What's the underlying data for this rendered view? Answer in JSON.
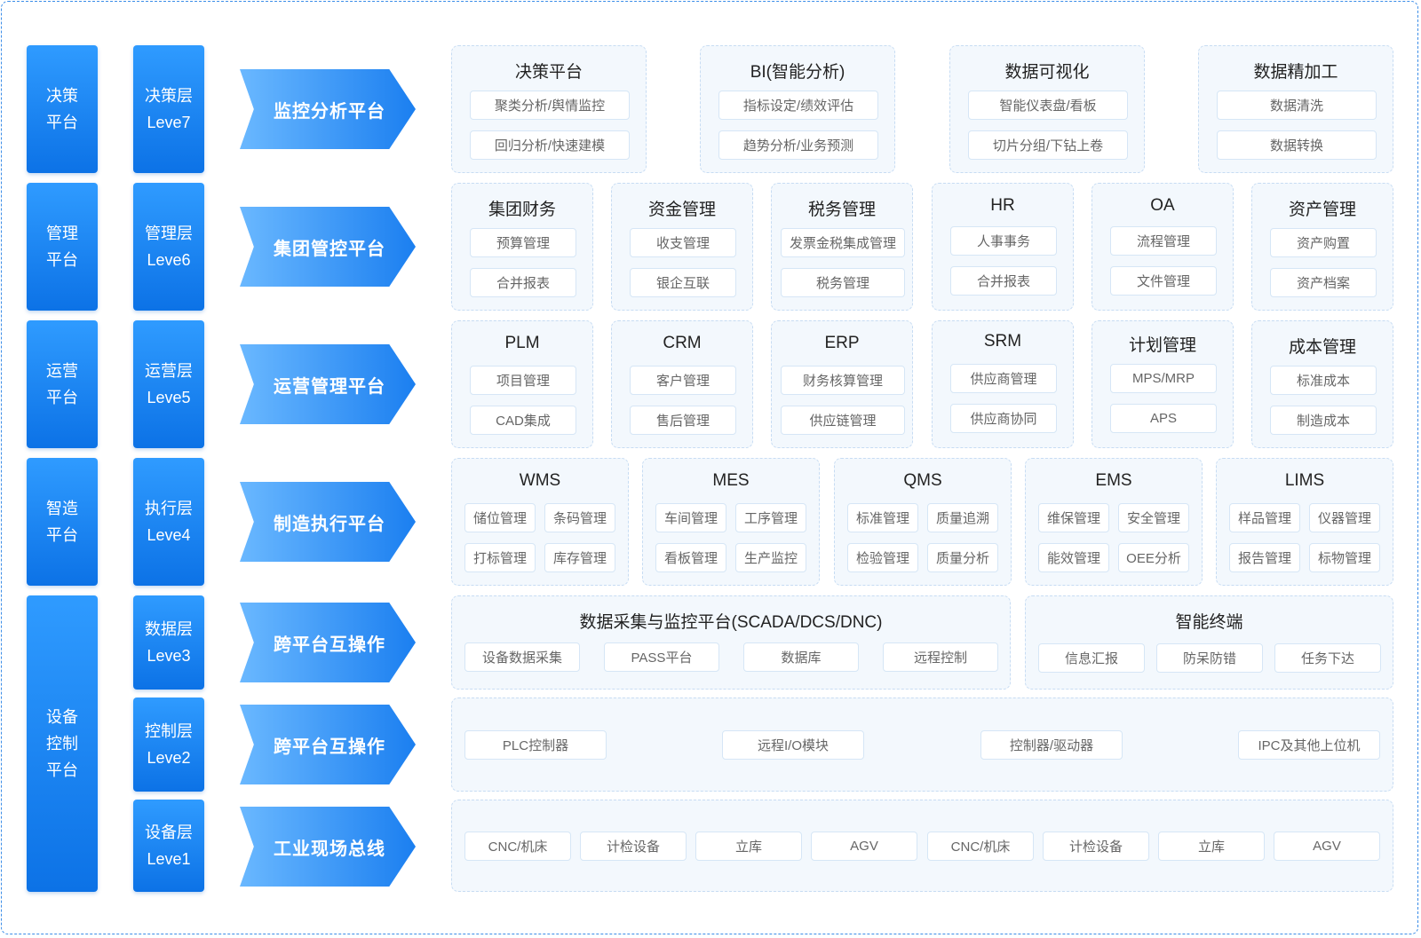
{
  "platforms": [
    "决策\n平台",
    "管理\n平台",
    "运营\n平台",
    "智造\n平台",
    "设备\n控制\n平台"
  ],
  "levels": [
    "决策层\nLeve7",
    "管理层\nLeve6",
    "运营层\nLeve5",
    "执行层\nLeve4",
    "数据层\nLeve3",
    "控制层\nLeve2",
    "设备层\nLeve1"
  ],
  "arrows": [
    "监控分析平台",
    "集团管控平台",
    "运营管理平台",
    "制造执行平台",
    "跨平台互操作",
    "跨平台互操作",
    "工业现场总线"
  ],
  "row7": [
    {
      "title": "决策平台",
      "items": [
        "聚类分析/舆情监控",
        "回归分析/快速建模"
      ]
    },
    {
      "title": "BI(智能分析)",
      "items": [
        "指标设定/绩效评估",
        "趋势分析/业务预测"
      ]
    },
    {
      "title": "数据可视化",
      "items": [
        "智能仪表盘/看板",
        "切片分组/下钻上卷"
      ]
    },
    {
      "title": "数据精加工",
      "items": [
        "数据清洗",
        "数据转换"
      ]
    }
  ],
  "row6": [
    {
      "title": "集团财务",
      "items": [
        "预算管理",
        "合并报表"
      ]
    },
    {
      "title": "资金管理",
      "items": [
        "收支管理",
        "银企互联"
      ]
    },
    {
      "title": "税务管理",
      "items": [
        "发票金税集成管理",
        "税务管理"
      ]
    },
    {
      "title": "HR",
      "items": [
        "人事事务",
        "合并报表"
      ]
    },
    {
      "title": "OA",
      "items": [
        "流程管理",
        "文件管理"
      ]
    },
    {
      "title": "资产管理",
      "items": [
        "资产购置",
        "资产档案"
      ]
    }
  ],
  "row5": [
    {
      "title": "PLM",
      "items": [
        "项目管理",
        "CAD集成"
      ]
    },
    {
      "title": "CRM",
      "items": [
        "客户管理",
        "售后管理"
      ]
    },
    {
      "title": "ERP",
      "items": [
        "财务核算管理",
        "供应链管理"
      ]
    },
    {
      "title": "SRM",
      "items": [
        "供应商管理",
        "供应商协同"
      ]
    },
    {
      "title": "计划管理",
      "items": [
        "MPS/MRP",
        "APS"
      ]
    },
    {
      "title": "成本管理",
      "items": [
        "标准成本",
        "制造成本"
      ]
    }
  ],
  "row4": [
    {
      "title": "WMS",
      "items": [
        "储位管理",
        "条码管理",
        "打标管理",
        "库存管理"
      ]
    },
    {
      "title": "MES",
      "items": [
        "车间管理",
        "工序管理",
        "看板管理",
        "生产监控"
      ]
    },
    {
      "title": "QMS",
      "items": [
        "标准管理",
        "质量追溯",
        "检验管理",
        "质量分析"
      ]
    },
    {
      "title": "EMS",
      "items": [
        "维保管理",
        "安全管理",
        "能效管理",
        "OEE分析"
      ]
    },
    {
      "title": "LIMS",
      "items": [
        "样品管理",
        "仪器管理",
        "报告管理",
        "标物管理"
      ]
    }
  ],
  "row3": [
    {
      "title": "数据采集与监控平台(SCADA/DCS/DNC)",
      "items": [
        "设备数据采集",
        "PASS平台",
        "数据库",
        "远程控制"
      ]
    },
    {
      "title": "智能终端",
      "items": [
        "信息汇报",
        "防呆防错",
        "任务下达"
      ]
    }
  ],
  "row2": {
    "items": [
      "PLC控制器",
      "远程I/O模块",
      "控制器/驱动器",
      "IPC及其他上位机"
    ]
  },
  "row1": {
    "items": [
      "CNC/机床",
      "计检设备",
      "立库",
      "AGV",
      "CNC/机床",
      "计检设备",
      "立库",
      "AGV"
    ]
  }
}
